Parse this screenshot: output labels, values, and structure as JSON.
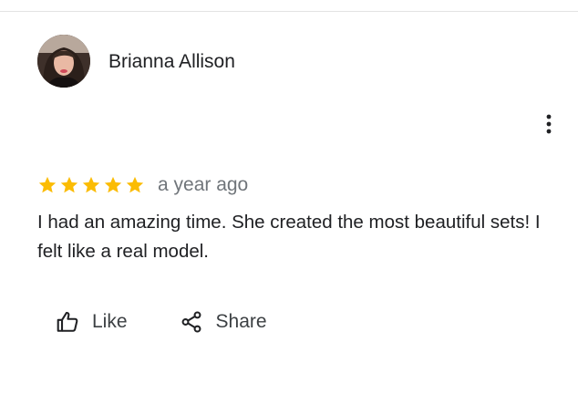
{
  "review": {
    "reviewer": {
      "name": "Brianna Allison",
      "avatar_icon": "user-photo"
    },
    "rating": 5,
    "max_rating": 5,
    "time": "a year ago",
    "text": "I had an amazing time. She created the most beautiful sets! I felt like a real model.",
    "more_icon": "more-vertical-icon"
  },
  "actions": {
    "like_label": "Like",
    "like_icon": "thumbs-up-icon",
    "share_label": "Share",
    "share_icon": "share-icon"
  },
  "colors": {
    "star": "#fbbc04",
    "text": "#202124",
    "secondary_text": "#70757a",
    "divider": "#e3e3e3"
  }
}
